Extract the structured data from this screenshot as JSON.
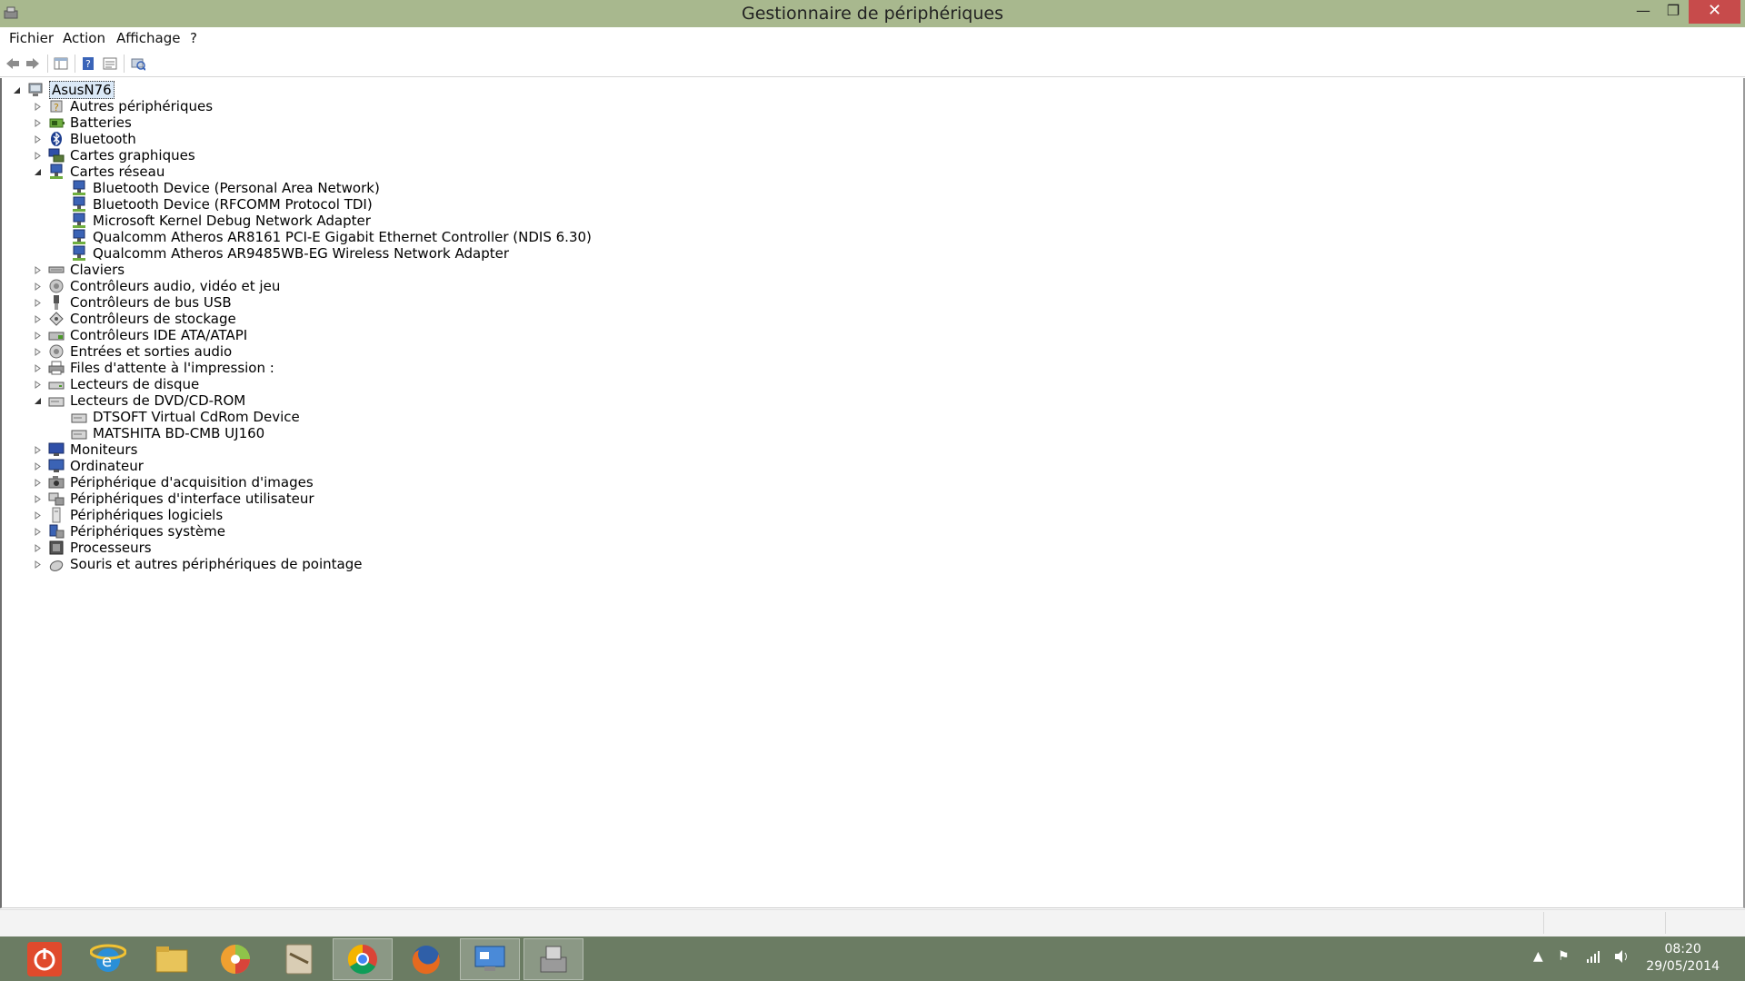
{
  "window": {
    "title": "Gestionnaire de périphériques",
    "controls": {
      "minimize": "—",
      "maximize": "❐",
      "close": "✕"
    }
  },
  "menu": [
    {
      "label": "Fichier"
    },
    {
      "label": "Action"
    },
    {
      "label": "Affichage"
    },
    {
      "label": "?"
    }
  ],
  "toolbar": {
    "buttons": [
      "back-icon",
      "forward-icon",
      "show-hide-tree-icon",
      "properties-icon",
      "help-icon",
      "scan-hardware-icon"
    ]
  },
  "tree": {
    "root": {
      "label": "AsusN76",
      "expanded": true
    },
    "categories": [
      {
        "label": "Autres périphériques",
        "icon": "unknown-device-icon",
        "expanded": false
      },
      {
        "label": "Batteries",
        "icon": "battery-icon",
        "expanded": false
      },
      {
        "label": "Bluetooth",
        "icon": "bluetooth-icon",
        "expanded": false
      },
      {
        "label": "Cartes graphiques",
        "icon": "display-adapter-icon",
        "expanded": false
      },
      {
        "label": "Cartes réseau",
        "icon": "network-adapter-icon",
        "expanded": true,
        "children": [
          "Bluetooth Device (Personal Area Network)",
          "Bluetooth Device (RFCOMM Protocol TDI)",
          "Microsoft Kernel Debug Network Adapter",
          "Qualcomm Atheros AR8161 PCI-E Gigabit Ethernet Controller (NDIS 6.30)",
          "Qualcomm Atheros AR9485WB-EG Wireless Network Adapter"
        ]
      },
      {
        "label": "Claviers",
        "icon": "keyboard-icon",
        "expanded": false
      },
      {
        "label": "Contrôleurs audio, vidéo et jeu",
        "icon": "audio-icon",
        "expanded": false
      },
      {
        "label": "Contrôleurs de bus USB",
        "icon": "usb-icon",
        "expanded": false
      },
      {
        "label": "Contrôleurs de stockage",
        "icon": "storage-controller-icon",
        "expanded": false
      },
      {
        "label": "Contrôleurs IDE ATA/ATAPI",
        "icon": "ide-icon",
        "expanded": false
      },
      {
        "label": "Entrées et sorties audio",
        "icon": "audio-io-icon",
        "expanded": false
      },
      {
        "label": "Files d'attente à l'impression :",
        "icon": "printer-icon",
        "expanded": false
      },
      {
        "label": "Lecteurs de disque",
        "icon": "disk-drive-icon",
        "expanded": false
      },
      {
        "label": "Lecteurs de DVD/CD-ROM",
        "icon": "dvd-drive-icon",
        "expanded": true,
        "children": [
          "DTSOFT Virtual CdRom Device",
          "MATSHITA BD-CMB UJ160"
        ]
      },
      {
        "label": "Moniteurs",
        "icon": "monitor-icon",
        "expanded": false
      },
      {
        "label": "Ordinateur",
        "icon": "computer-icon",
        "expanded": false
      },
      {
        "label": "Périphérique d'acquisition d'images",
        "icon": "camera-icon",
        "expanded": false
      },
      {
        "label": "Périphériques d'interface utilisateur",
        "icon": "hid-icon",
        "expanded": false
      },
      {
        "label": "Périphériques logiciels",
        "icon": "software-device-icon",
        "expanded": false
      },
      {
        "label": "Périphériques système",
        "icon": "system-device-icon",
        "expanded": false
      },
      {
        "label": "Processeurs",
        "icon": "processor-icon",
        "expanded": false
      },
      {
        "label": "Souris et autres périphériques de pointage",
        "icon": "mouse-icon",
        "expanded": false
      }
    ]
  },
  "taskbar": {
    "apps": [
      {
        "name": "power-app",
        "active": false
      },
      {
        "name": "internet-explorer",
        "active": false
      },
      {
        "name": "file-explorer",
        "active": false
      },
      {
        "name": "media-app",
        "active": false
      },
      {
        "name": "tools-app",
        "active": false
      },
      {
        "name": "chrome",
        "active": true
      },
      {
        "name": "firefox",
        "active": false
      },
      {
        "name": "control-panel",
        "active": true
      },
      {
        "name": "device-manager",
        "active": true
      }
    ],
    "clock": {
      "time": "08:20",
      "date": "29/05/2014"
    }
  },
  "colors": {
    "titlebar": "#a8b88e",
    "taskbar": "#6b7c63",
    "close": "#c74b4b",
    "selection": "#dbe9f7"
  }
}
